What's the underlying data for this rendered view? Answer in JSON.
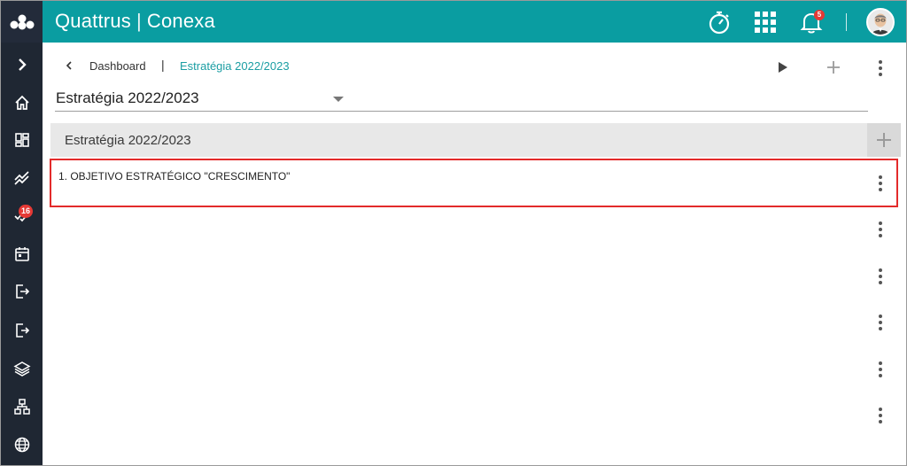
{
  "header": {
    "brand": "Quattrus",
    "product": "Conexa",
    "separator": "|",
    "notification_count": "5"
  },
  "sidebar": {
    "items": [
      {
        "name": "expand",
        "icon": "chevron-right-icon"
      },
      {
        "name": "home",
        "icon": "home-icon"
      },
      {
        "name": "dashboard",
        "icon": "dashboard-icon"
      },
      {
        "name": "trend",
        "icon": "trend-icon"
      },
      {
        "name": "tasks",
        "icon": "double-check-icon",
        "badge": "16"
      },
      {
        "name": "calendar",
        "icon": "calendar-icon"
      },
      {
        "name": "import",
        "icon": "login-icon"
      },
      {
        "name": "export",
        "icon": "logout-icon"
      },
      {
        "name": "layers",
        "icon": "layers-icon"
      },
      {
        "name": "hierarchy",
        "icon": "hierarchy-icon"
      },
      {
        "name": "globe",
        "icon": "globe-icon"
      }
    ]
  },
  "breadcrumb": {
    "parent": "Dashboard",
    "separator": "|",
    "current": "Estratégia 2022/2023"
  },
  "selector": {
    "value": "Estratégia 2022/2023"
  },
  "section": {
    "title": "Estratégia 2022/2023"
  },
  "items": [
    {
      "label": "1. OBJETIVO ESTRATÉGICO \"CRESCIMENTO\""
    }
  ],
  "colors": {
    "header": "#0a9da1",
    "sidebar": "#1f2733",
    "badge": "#e53935",
    "highlight": "#e32b2b",
    "link": "#1b9ea3"
  }
}
